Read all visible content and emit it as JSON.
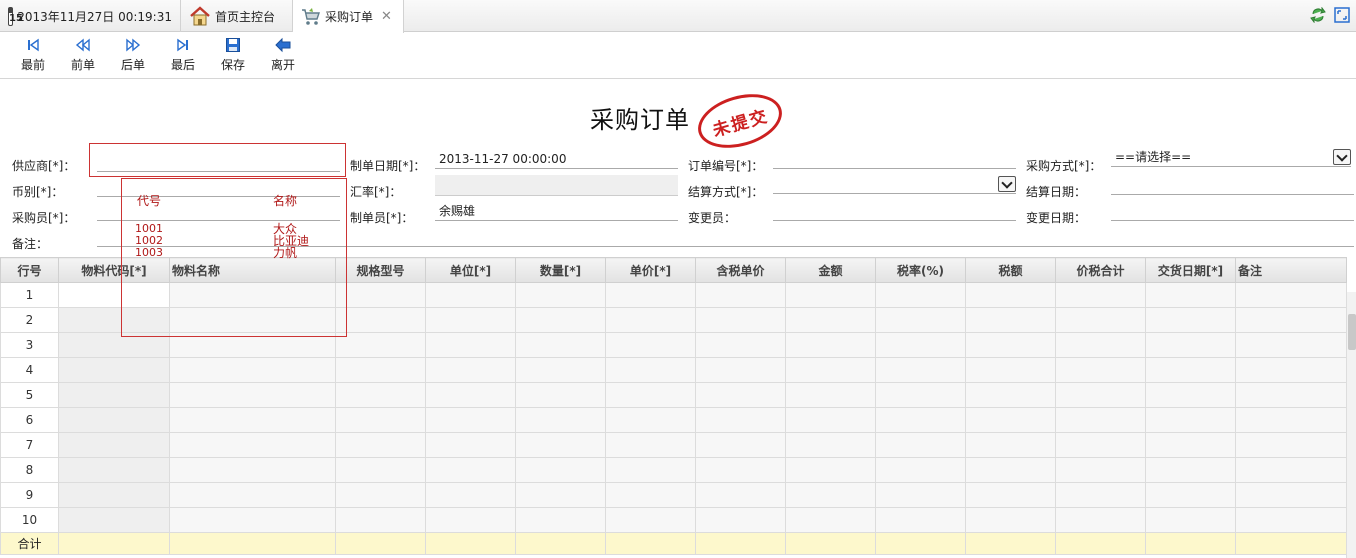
{
  "tabs": [
    {
      "label": "2013年11月27日 00:19:31",
      "icon": "calendar-icon",
      "icon_text": "15"
    },
    {
      "label": "首页主控台",
      "icon": "home-icon"
    },
    {
      "label": "采购订单",
      "icon": "cart-icon",
      "closable": true
    }
  ],
  "tab_close_glyph": "✕",
  "toolbar": {
    "first": "最前",
    "prev": "前单",
    "next": "后单",
    "last": "最后",
    "save": "保存",
    "exit": "离开"
  },
  "form": {
    "title": "采购订单",
    "stamp": "未提交",
    "supplier_label": "供应商[*]：",
    "supplier_value": "",
    "make_date_label": "制单日期[*]：",
    "make_date_value": "2013-11-27 00:00:00",
    "order_no_label": "订单编号[*]：",
    "order_no_value": "",
    "purchase_method_label": "采购方式[*]：",
    "purchase_method_value": "==请选择==",
    "currency_label": "币别[*]：",
    "currency_value": "",
    "exchange_rate_label": "汇率[*]：",
    "exchange_rate_value": "",
    "settle_method_label": "结算方式[*]：",
    "settle_method_value": "",
    "settle_date_label": "结算日期：",
    "settle_date_value": "",
    "buyer_label": "采购员[*]：",
    "buyer_value": "",
    "maker_label": "制单员[*]：",
    "maker_value": "余赐雄",
    "changer_label": "变更员：",
    "changer_value": "",
    "change_date_label": "变更日期：",
    "change_date_value": "",
    "remark_label": "备注：",
    "remark_value": ""
  },
  "supplier_popup": {
    "header_code": "代号",
    "header_name": "名称",
    "rows": [
      {
        "code": "1001",
        "name": "大众"
      },
      {
        "code": "1002",
        "name": "比亚迪"
      },
      {
        "code": "1003",
        "name": "力帆"
      }
    ]
  },
  "grid": {
    "columns": [
      "行号",
      "物料代码[*]",
      "物料名称",
      "规格型号",
      "单位[*]",
      "数量[*]",
      "单价[*]",
      "含税单价",
      "金额",
      "税率(%)",
      "税额",
      "价税合计",
      "交货日期[*]",
      "备注"
    ],
    "row_numbers": [
      "1",
      "2",
      "3",
      "4",
      "5",
      "6",
      "7",
      "8",
      "9",
      "10"
    ],
    "total_label": "合计"
  },
  "colors": {
    "accent_red": "#cc2020",
    "toolbar_icon_blue": "#2a6fd0",
    "total_row": "#fdf8cc"
  }
}
